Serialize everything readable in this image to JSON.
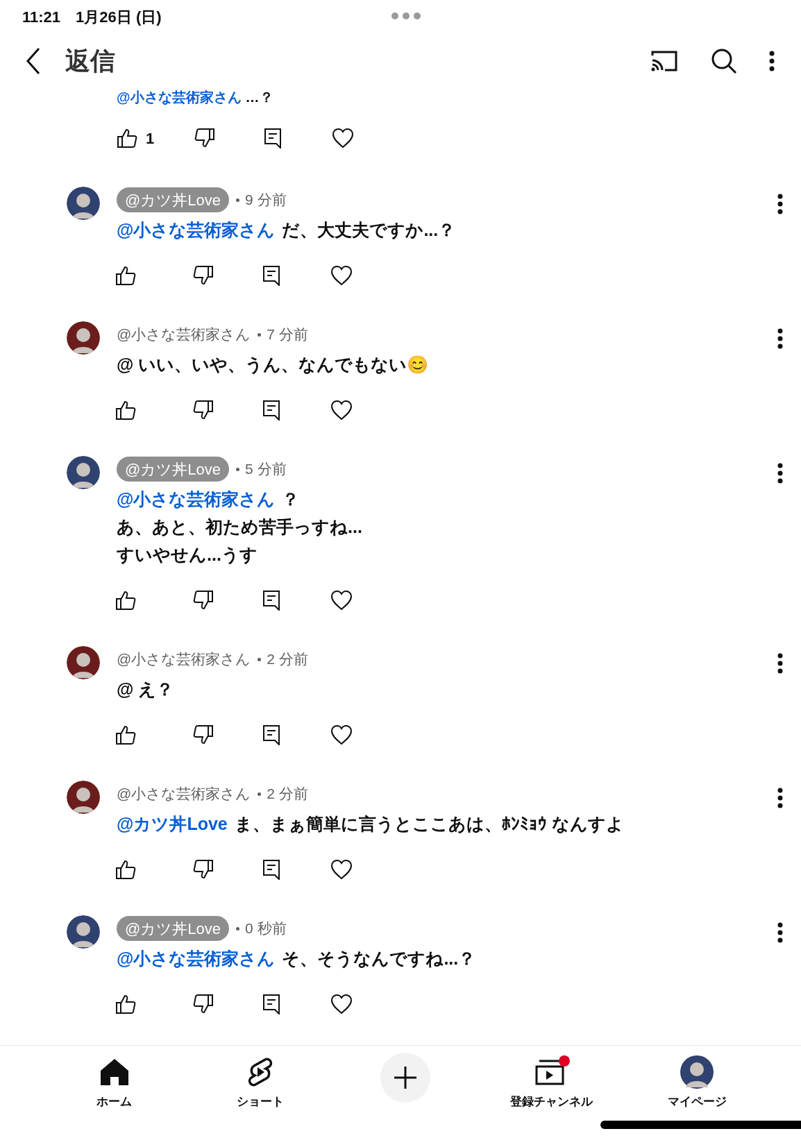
{
  "status_bar": {
    "time": "11:21",
    "date": "1月26日 (日)"
  },
  "header": {
    "title": "返信"
  },
  "partial_comment": {
    "mention": "@小さな芸術家さん",
    "text": "…？",
    "like_count": "1"
  },
  "comments": [
    {
      "author": "@カツ丼Love",
      "author_badge": true,
      "time": "9 分前",
      "color": "#2f4270",
      "mention": "@小さな芸術家さん",
      "lines": [
        "だ、大丈夫ですか...？"
      ]
    },
    {
      "author": "@小さな芸術家さん",
      "author_badge": false,
      "time": "7 分前",
      "color": "#6b1d1d",
      "lines": [
        "@ いい、いや、うん、なんでもない😊"
      ]
    },
    {
      "author": "@カツ丼Love",
      "author_badge": true,
      "time": "5 分前",
      "color": "#2f4270",
      "mention": "@小さな芸術家さん",
      "lines": [
        "？",
        "あ、あと、初ため苦手っすね...",
        "すいやせん...うす"
      ]
    },
    {
      "author": "@小さな芸術家さん",
      "author_badge": false,
      "time": "2 分前",
      "color": "#6b1d1d",
      "lines": [
        "@ え？"
      ]
    },
    {
      "author": "@小さな芸術家さん",
      "author_badge": false,
      "time": "2 分前",
      "color": "#6b1d1d",
      "mention": "@カツ丼Love",
      "lines": [
        "ま、まぁ簡単に言うとここあは、ﾎﾝﾐｮｳ なんすよ"
      ]
    },
    {
      "author": "@カツ丼Love",
      "author_badge": true,
      "time": "0 秒前",
      "color": "#2f4270",
      "mention": "@小さな芸術家さん",
      "lines": [
        "そ、そうなんですね...？"
      ]
    }
  ],
  "bottom_nav": [
    {
      "kind": "home",
      "label": "ホーム"
    },
    {
      "kind": "shorts",
      "label": "ショート"
    },
    {
      "kind": "create"
    },
    {
      "kind": "subscriptions",
      "label": "登録チャンネル",
      "badge": true
    },
    {
      "kind": "profile",
      "label": "マイページ"
    }
  ]
}
